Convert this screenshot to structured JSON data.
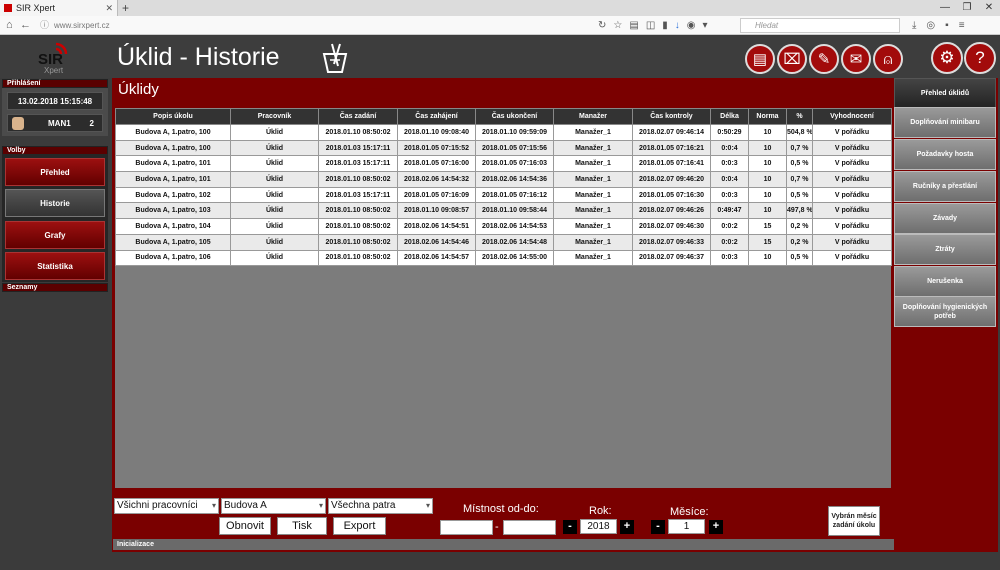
{
  "browser": {
    "tab_title": "SIR Xpert",
    "url": "www.sirxpert.cz",
    "search_placeholder": "Hledat"
  },
  "app": {
    "title": "Úklid - Historie"
  },
  "sidebar": {
    "login_header": "Přihlášení",
    "datetime": "13.02.2018 15:15:48",
    "user": "MAN1",
    "user_count": "2",
    "volby_header": "Volby",
    "items": [
      {
        "label": "Přehled"
      },
      {
        "label": "Historie"
      },
      {
        "label": "Grafy"
      },
      {
        "label": "Statistika"
      }
    ],
    "seznamy_header": "Seznamy"
  },
  "panel": {
    "title": "Úklidy"
  },
  "table": {
    "columns": [
      "Popis úkolu",
      "Pracovník",
      "Čas zadání",
      "Čas zahájení",
      "Čas ukončení",
      "Manažer",
      "Čas kontroly",
      "Délka",
      "Norma",
      "%",
      "Vyhodnocení"
    ],
    "rows": [
      [
        "Budova A, 1.patro, 100",
        "Úklid",
        "2018.01.10 08:50:02",
        "2018.01.10 09:08:40",
        "2018.01.10 09:59:09",
        "Manažer_1",
        "2018.02.07 09:46:14",
        "0:50:29",
        "10",
        "504,8 %",
        "V pořádku"
      ],
      [
        "Budova A, 1.patro, 100",
        "Úklid",
        "2018.01.03 15:17:11",
        "2018.01.05 07:15:52",
        "2018.01.05 07:15:56",
        "Manažer_1",
        "2018.01.05 07:16:21",
        "0:0:4",
        "10",
        "0,7 %",
        "V pořádku"
      ],
      [
        "Budova A, 1.patro, 101",
        "Úklid",
        "2018.01.03 15:17:11",
        "2018.01.05 07:16:00",
        "2018.01.05 07:16:03",
        "Manažer_1",
        "2018.01.05 07:16:41",
        "0:0:3",
        "10",
        "0,5 %",
        "V pořádku"
      ],
      [
        "Budova A, 1.patro, 101",
        "Úklid",
        "2018.01.10 08:50:02",
        "2018.02.06 14:54:32",
        "2018.02.06 14:54:36",
        "Manažer_1",
        "2018.02.07 09:46:20",
        "0:0:4",
        "10",
        "0,7 %",
        "V pořádku"
      ],
      [
        "Budova A, 1.patro, 102",
        "Úklid",
        "2018.01.03 15:17:11",
        "2018.01.05 07:16:09",
        "2018.01.05 07:16:12",
        "Manažer_1",
        "2018.01.05 07:16:30",
        "0:0:3",
        "10",
        "0,5 %",
        "V pořádku"
      ],
      [
        "Budova A, 1.patro, 103",
        "Úklid",
        "2018.01.10 08:50:02",
        "2018.01.10 09:08:57",
        "2018.01.10 09:58:44",
        "Manažer_1",
        "2018.02.07 09:46:26",
        "0:49:47",
        "10",
        "497,8 %",
        "V pořádku"
      ],
      [
        "Budova A, 1.patro, 104",
        "Úklid",
        "2018.01.10 08:50:02",
        "2018.02.06 14:54:51",
        "2018.02.06 14:54:53",
        "Manažer_1",
        "2018.02.07 09:46:30",
        "0:0:2",
        "15",
        "0,2 %",
        "V pořádku"
      ],
      [
        "Budova A, 1.patro, 105",
        "Úklid",
        "2018.01.10 08:50:02",
        "2018.02.06 14:54:46",
        "2018.02.06 14:54:48",
        "Manažer_1",
        "2018.02.07 09:46:33",
        "0:0:2",
        "15",
        "0,2 %",
        "V pořádku"
      ],
      [
        "Budova A, 1.patro, 106",
        "Úklid",
        "2018.01.10 08:50:02",
        "2018.02.06 14:54:57",
        "2018.02.06 14:55:00",
        "Manažer_1",
        "2018.02.07 09:46:37",
        "0:0:3",
        "10",
        "0,5 %",
        "V pořádku"
      ]
    ]
  },
  "filters": {
    "worker": "Všichni pracovníci",
    "building": "Budova A",
    "floor": "Všechna patra",
    "refresh_label": "Obnovit",
    "print_label": "Tisk",
    "export_label": "Export",
    "room_label": "Místnost od-do:",
    "room_from": "",
    "room_to": "",
    "room_dash": "-",
    "year_label": "Rok:",
    "year": "2018",
    "month_label": "Měsíce:",
    "month": "1",
    "minus": "-",
    "plus": "+",
    "vybran_label": "Vybrán měsíc zadání úkolu"
  },
  "status": "Inicializace",
  "right_sidebar": {
    "items": [
      {
        "label": "Přehled úklidů"
      },
      {
        "label": "Doplňování minibaru"
      },
      {
        "label": "Požadavky hosta"
      },
      {
        "label": "Ručníky a přestlání"
      },
      {
        "label": "Závady"
      },
      {
        "label": "Ztráty"
      },
      {
        "label": "Nerušenka"
      },
      {
        "label": "Doplňování hygienických potřeb"
      }
    ]
  },
  "icons": {
    "header_buttons": [
      "document-icon",
      "cleaning-icon",
      "wrench-icon",
      "envelope-icon",
      "bell-icon"
    ],
    "settings": "gear-icon",
    "help": "help-icon"
  },
  "colors": {
    "accent": "#7a0000",
    "button_red": "#a20b0b"
  }
}
